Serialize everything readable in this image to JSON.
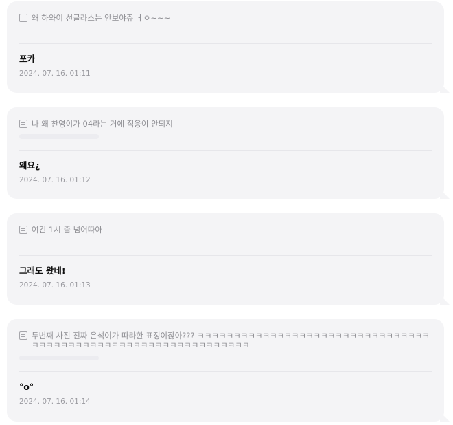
{
  "posts": [
    {
      "question": "왜 하와이 선글라스는 안보야쥬 ㅓㅇ~~~",
      "answer": "포카",
      "date": "2024. 07. 16. 01:11"
    },
    {
      "question": "나 왜 찬영이가 04라는 거에 적응이 안되지",
      "answer": "왜요¿",
      "date": "2024. 07. 16. 01:12"
    },
    {
      "question": "여긴 1시 좀 넘어따아",
      "answer": "그래도 왔네!",
      "date": "2024. 07. 16. 01:13"
    },
    {
      "question": "두번째 사진 진짜 은석이가 따라한 표정이잖아??? ㅋㅋㅋㅋㅋㅋㅋㅋㅋㅋㅋㅋㅋㅋㅋㅋㅋㅋㅋㅋㅋㅋㅋㅋㅋㅋㅋㅋㅋㅋㅋㅋㅋㅋㅋㅋㅋㅋㅋㅋㅋㅋㅋㅋㅋㅋㅋㅋㅋㅋㅋㅋㅋㅋㅋㅋㅋㅋㅋㅋㅋㅋ",
      "answer": "°o°",
      "date": "2024. 07. 16. 01:14"
    }
  ]
}
